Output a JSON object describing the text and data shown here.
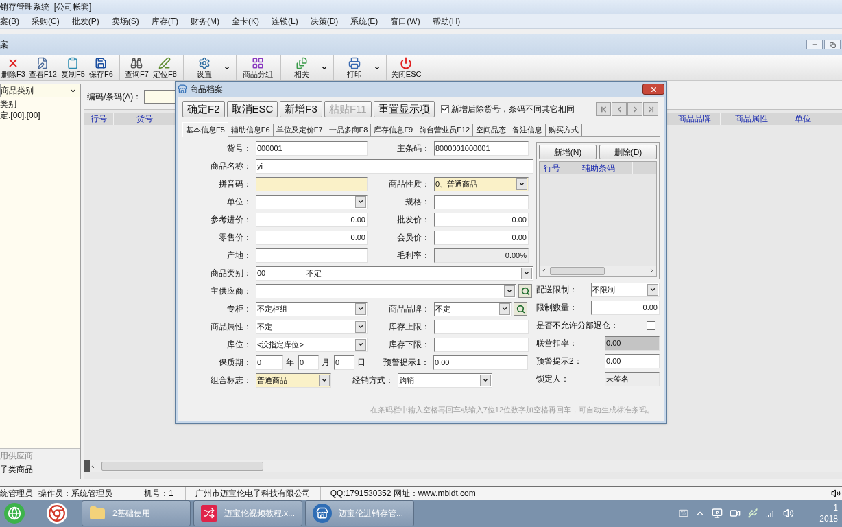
{
  "window": {
    "title": "销存管理系统  [公司帐套]"
  },
  "menu": [
    "案(B)",
    "采购(C)",
    "批发(P)",
    "卖场(S)",
    "库存(T)",
    "财务(M)",
    "金卡(K)",
    "连锁(L)",
    "决策(D)",
    "系统(E)",
    "窗口(W)",
    "帮助(H)"
  ],
  "child_window": {
    "title": "案"
  },
  "toolbar": [
    [
      {
        "label": "删除F3",
        "kind": "button"
      },
      {
        "label": "查看F12",
        "kind": "button"
      },
      {
        "label": "复制F5",
        "kind": "button"
      },
      {
        "label": "保存F6",
        "kind": "button"
      }
    ],
    [
      {
        "label": "查询F7",
        "kind": "button"
      },
      {
        "label": "定位F8",
        "kind": "button"
      }
    ],
    [
      {
        "label": "设置",
        "kind": "dropdown"
      }
    ],
    [
      {
        "label": "商品分组",
        "kind": "button"
      }
    ],
    [
      {
        "label": "相关",
        "kind": "dropdown"
      }
    ],
    [
      {
        "label": "打印",
        "kind": "dropdown"
      }
    ],
    [
      {
        "label": "关闭ESC",
        "kind": "button"
      }
    ]
  ],
  "sidebar": {
    "category_select": "商品类别",
    "items": [
      "类别",
      "定.[00].[00]"
    ],
    "bottom_items": [
      {
        "label": "用供应商",
        "disabled": true
      },
      {
        "label": "子类商品",
        "disabled": false
      }
    ]
  },
  "search": {
    "label": "编码/条码(A)："
  },
  "table": {
    "columns": [
      "行号",
      "货号",
      "商品品牌",
      "商品属性",
      "单位"
    ]
  },
  "dialog": {
    "title": "商品档案",
    "buttons": [
      {
        "label": "确定F2",
        "disabled": false
      },
      {
        "label": "取消ESC",
        "disabled": false
      },
      {
        "label": "新增F3",
        "disabled": false
      },
      {
        "label": "粘贴F11",
        "disabled": true
      },
      {
        "label": "重置显示项",
        "disabled": false
      }
    ],
    "option": {
      "label": "新增后除货号，条码不同其它相同",
      "checked": true
    },
    "tabs": [
      {
        "label": "基本信息F5",
        "selected": true
      },
      {
        "label": "辅助信息F6",
        "selected": false
      },
      {
        "label": "单位及定价F7",
        "selected": false
      },
      {
        "label": "一品多商F8",
        "selected": false
      },
      {
        "label": "库存信息F9",
        "selected": false
      },
      {
        "label": "前台营业员F12",
        "selected": false
      },
      {
        "label": "空间品态",
        "selected": false
      },
      {
        "label": "备注信息",
        "selected": false
      },
      {
        "label": "购买方式",
        "selected": false
      }
    ],
    "form": {
      "rows": [
        {
          "cells": [
            {
              "label": "货号：",
              "kind": "text",
              "value": "000001",
              "tinted": false
            },
            {
              "label": "主条码：",
              "kind": "text",
              "value": "8000001000001",
              "tinted": false
            }
          ]
        },
        {
          "cells": [
            {
              "label": "商品名称：",
              "kind": "text",
              "value": "yi",
              "tinted": false
            }
          ]
        },
        {
          "cells": [
            {
              "label": "拼音码：",
              "kind": "text",
              "tinted": true
            },
            {
              "label": "商品性质：",
              "kind": "select",
              "value": "0、普通商品",
              "tinted": true
            }
          ]
        },
        {
          "cells": [
            {
              "label": "单位：",
              "kind": "select",
              "tinted": false
            },
            {
              "label": "规格：",
              "kind": "text",
              "tinted": false
            }
          ]
        },
        {
          "cells": [
            {
              "label": "参考进价：",
              "kind": "number",
              "value": "0.00",
              "tinted": false
            },
            {
              "label": "批发价：",
              "kind": "number",
              "value": "0.00",
              "tinted": false
            }
          ]
        },
        {
          "cells": [
            {
              "label": "零售价：",
              "kind": "number",
              "value": "0.00",
              "tinted": false
            },
            {
              "label": "会员价：",
              "kind": "number",
              "value": "0.00",
              "tinted": false
            }
          ]
        },
        {
          "cells": [
            {
              "label": "产地：",
              "kind": "text",
              "tinted": false
            },
            {
              "label": "毛利率：",
              "kind": "readonly_number",
              "value": "0.00%"
            }
          ]
        },
        {
          "cells": [
            {
              "label": "商品类别：",
              "kind": "select",
              "value": "00",
              "detail": "不定",
              "tinted": false
            }
          ]
        },
        {
          "cells": [
            {
              "label": "主供应商：",
              "kind": "lookup",
              "tinted": false
            }
          ]
        },
        {
          "cells": [
            {
              "label": "专柜：",
              "kind": "select",
              "value": "不定柜组",
              "tinted": false
            },
            {
              "label": "商品品牌：",
              "kind": "lookup",
              "value": "不定",
              "tinted": false
            }
          ]
        },
        {
          "cells": [
            {
              "label": "商品属性：",
              "kind": "select",
              "value": "不定",
              "tinted": false
            },
            {
              "label": "库存上限：",
              "kind": "text",
              "tinted": false
            }
          ]
        },
        {
          "cells": [
            {
              "label": "库位：",
              "kind": "select",
              "value": "<没指定库位>",
              "tinted": false
            },
            {
              "label": "库存下限：",
              "kind": "text",
              "tinted": false
            }
          ]
        },
        {
          "cells": [
            {
              "label": "保质期：",
              "kind": "period",
              "parts": [
                {
                  "value": "0",
                  "unit": "年"
                },
                {
                  "value": "0",
                  "unit": "月"
                },
                {
                  "value": "0",
                  "unit": "日"
                }
              ],
              "tinted": false
            },
            {
              "label": "预警提示1：",
              "kind": "text",
              "value": "0.00",
              "tinted": false
            }
          ]
        },
        {
          "cells": [
            {
              "label": "组合标志：",
              "kind": "combo",
              "value": "普通商品",
              "tinted": true
            },
            {
              "label": "经销方式：",
              "kind": "select",
              "value": "购销",
              "tinted": false
            }
          ]
        }
      ]
    },
    "side": {
      "buttons": [
        "新增(N)",
        "删除(D)"
      ],
      "columns": [
        "行号",
        "辅助条码"
      ],
      "rows": [
        {
          "label": "配送限制：",
          "kind": "select",
          "value": "不限制"
        },
        {
          "label": "限制数量：",
          "kind": "number",
          "value": "0.00"
        },
        {
          "label": "是否不允许分部退仓：",
          "kind": "check",
          "checked": false
        },
        {
          "label": "联营扣率：",
          "kind": "disabled",
          "value": "0.00"
        },
        {
          "label": "预警提示2：",
          "kind": "text",
          "value": "0.00"
        },
        {
          "label": "锁定人：",
          "kind": "readonly",
          "value": "未签名"
        }
      ]
    },
    "hint": "在条码栏中输入空格再回车或输入7位12位数字加空格再回车，可自动生成标准条码。"
  },
  "status_bar": [
    "统管理员",
    "操作员：系统管理员",
    "机号：1",
    "广州市迈宝伦电子科技有限公司",
    "QQ:1791530352 网址：www.mbldt.com"
  ],
  "taskbar": {
    "buttons": [
      {
        "label": "2基础使用",
        "kind": "folder"
      },
      {
        "label": "迈宝伦视频教程.x...",
        "kind": "mindmap"
      },
      {
        "label": "迈宝伦进销存管...",
        "kind": "store"
      }
    ],
    "clock": [
      "1",
      "2018"
    ]
  }
}
